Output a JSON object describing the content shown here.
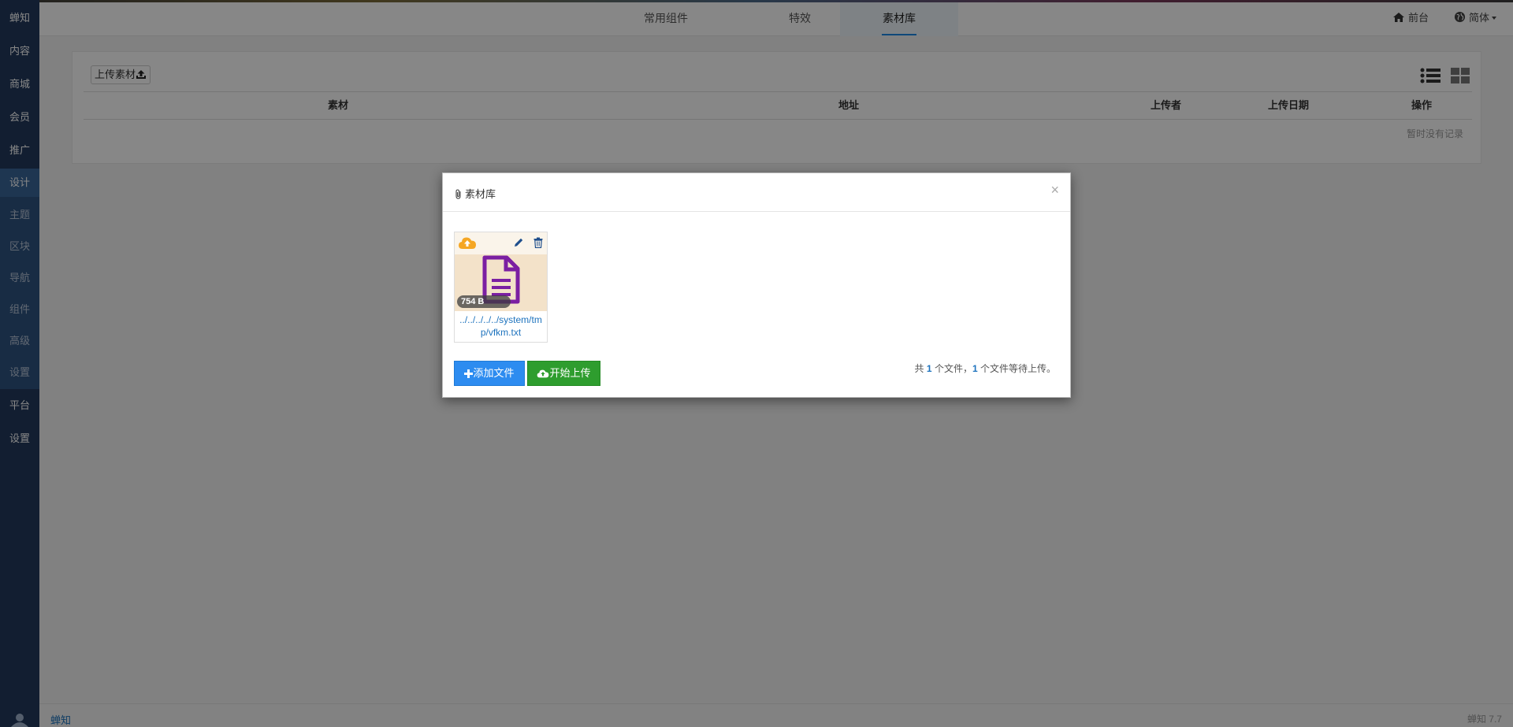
{
  "sidebar": {
    "items": [
      {
        "label": "蝉知"
      },
      {
        "label": "内容"
      },
      {
        "label": "商城"
      },
      {
        "label": "会员"
      },
      {
        "label": "推广"
      },
      {
        "label": "设计"
      },
      {
        "label": "主题"
      },
      {
        "label": "区块"
      },
      {
        "label": "导航"
      },
      {
        "label": "组件"
      },
      {
        "label": "高级"
      },
      {
        "label": "设置"
      },
      {
        "label": "平台"
      },
      {
        "label": "设置"
      }
    ]
  },
  "topbar": {
    "tabs": [
      {
        "label": "常用组件"
      },
      {
        "label": "特效"
      },
      {
        "label": "素材库"
      }
    ],
    "frontend_label": "前台",
    "language_label": "简体"
  },
  "panel": {
    "upload_label": "上传素材",
    "columns": [
      "素材",
      "地址",
      "上传者",
      "上传日期",
      "操作"
    ],
    "empty_text": "暂时没有记录"
  },
  "footer": {
    "brand": "蝉知",
    "version": "蝉知 7.7"
  },
  "modal": {
    "title": "素材库",
    "close": "×",
    "file": {
      "size": "754 B",
      "name": "../../../../../system/tmp/vfkm.txt"
    },
    "add_label": "添加文件",
    "start_label": "开始上传",
    "summary": {
      "prefix": "共",
      "total": "1",
      "middle": "个文件，",
      "pending": "1",
      "suffix": "个文件等待上传。"
    }
  },
  "colors": {
    "sidebar": "#223a5e",
    "accent": "#1e88e5",
    "add_button": "#2d8cf0",
    "start_button": "#2e9d2e",
    "file_icon": "#7b1fa2",
    "upload_icon": "#f5a623"
  }
}
